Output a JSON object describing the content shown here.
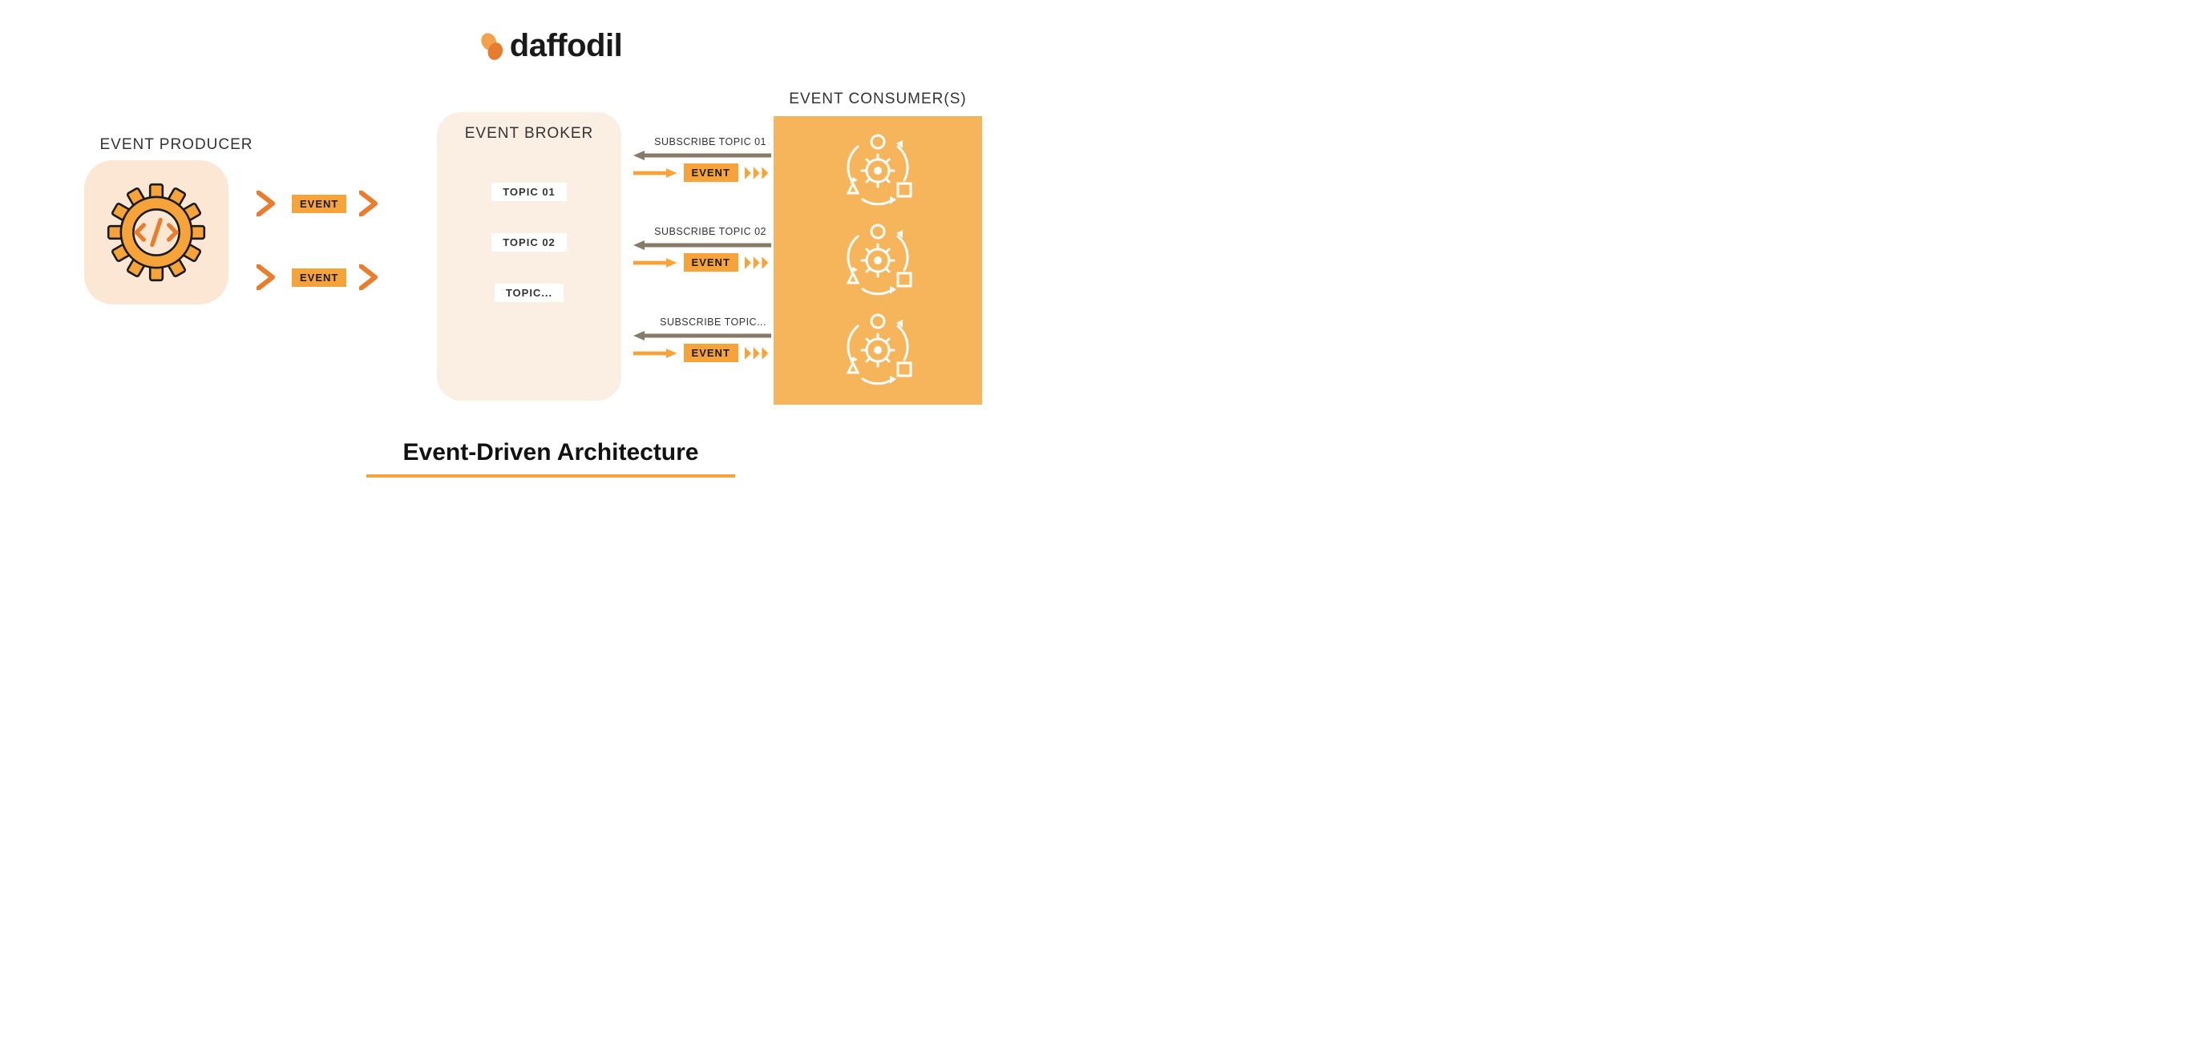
{
  "logo": {
    "text": "daffodil"
  },
  "title": "Event-Driven Architecture",
  "producer": {
    "label": "EVENT PRODUCER"
  },
  "broker": {
    "label": "EVENT BROKER",
    "topics": [
      "TOPIC 01",
      "TOPIC 02",
      "TOPIC..."
    ]
  },
  "consumers": {
    "label": "EVENT CONSUMER(S)"
  },
  "producer_events": [
    "EVENT",
    "EVENT"
  ],
  "lanes": [
    {
      "subscribe": "SUBSCRIBE TOPIC 01",
      "event": "EVENT"
    },
    {
      "subscribe": "SUBSCRIBE TOPIC 02",
      "event": "EVENT"
    },
    {
      "subscribe": "SUBSCRIBE TOPIC...",
      "event": "EVENT"
    }
  ],
  "colors": {
    "orange": "#F6A33A",
    "orange_dark": "#EA7C2B",
    "peach": "#FBE7D4",
    "peach_light": "#FBEFE4",
    "taupe": "#867A68"
  }
}
